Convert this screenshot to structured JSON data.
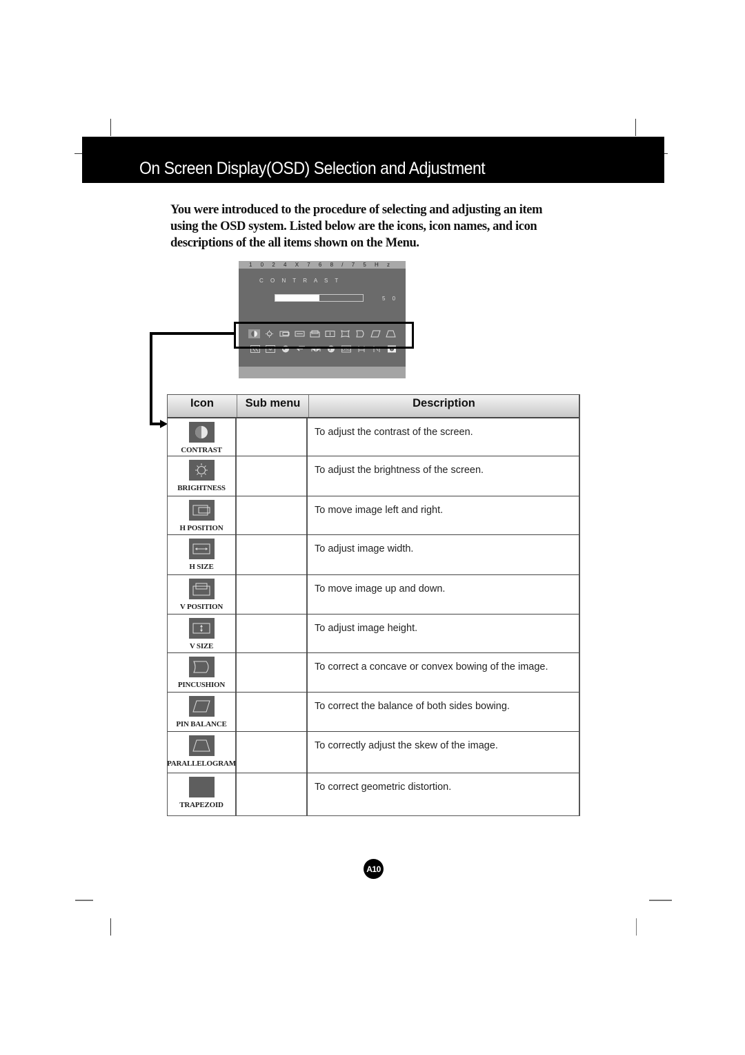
{
  "header": {
    "title": "On Screen Display(OSD) Selection and Adjustment"
  },
  "intro": {
    "text": "You were introduced to the procedure of selecting and adjusting an item using the OSD system.  Listed below are the icons, icon names, and icon descriptions of the all items shown on the Menu."
  },
  "osd": {
    "resolution": "1 0 2 4 X 7 6 8 / 7 5 H z",
    "item_name": "C O N T R A S T",
    "value_label": "5 0",
    "value_percent": 50,
    "row1_icons": [
      "contrast-icon",
      "brightness-icon",
      "h-position-icon",
      "h-size-icon",
      "v-position-icon",
      "v-size-icon",
      "pincushion-icon",
      "pin-balance-icon",
      "parallelogram-icon",
      "trapezoid-icon"
    ],
    "row2_icons": [
      "back-icon",
      "color-icon",
      "language-icon",
      "return-icon",
      "sharpness-icon",
      "globe-icon",
      "osd-icon",
      "tilt-icon",
      "setup-icon",
      "info-icon"
    ],
    "row2_osd_text": "OSD",
    "row2_info_text": "i",
    "colors": {
      "panel": "#6b6b6b",
      "topbar": "#a8a8a8",
      "fill": "#ffffff"
    }
  },
  "table": {
    "headers": {
      "icon": "Icon",
      "submenu": "Sub menu",
      "description": "Description"
    },
    "rows": [
      {
        "icon": "contrast-icon",
        "label": "CONTRAST",
        "submenu": "",
        "description": "To adjust the contrast of the screen."
      },
      {
        "icon": "brightness-icon",
        "label": "BRIGHTNESS",
        "submenu": "",
        "description": "To adjust the brightness of the screen."
      },
      {
        "icon": "h-position-icon",
        "label": "H POSITION",
        "submenu": "",
        "description": "To move image left and right."
      },
      {
        "icon": "h-size-icon",
        "label": "H SIZE",
        "submenu": "",
        "description": "To adjust image width."
      },
      {
        "icon": "v-position-icon",
        "label": "V POSITION",
        "submenu": "",
        "description": "To move image up and down."
      },
      {
        "icon": "v-size-icon",
        "label": "V SIZE",
        "submenu": "",
        "description": "To adjust image height."
      },
      {
        "icon": "pincushion-icon",
        "label": "PINCUSHION",
        "submenu": "",
        "description": "To correct a concave or convex bowing of the image."
      },
      {
        "icon": "pin-balance-icon",
        "label": "PIN BALANCE",
        "submenu": "",
        "description": "To correct the balance of both sides bowing."
      },
      {
        "icon": "parallelogram-icon",
        "label": "PARALLELOGRAM",
        "submenu": "",
        "description": "To correctly adjust the skew of the image."
      },
      {
        "icon": "trapezoid-icon",
        "label": "TRAPEZOID",
        "submenu": "",
        "description": "To correct geometric distortion."
      }
    ]
  },
  "footer": {
    "page_number": "A10"
  }
}
